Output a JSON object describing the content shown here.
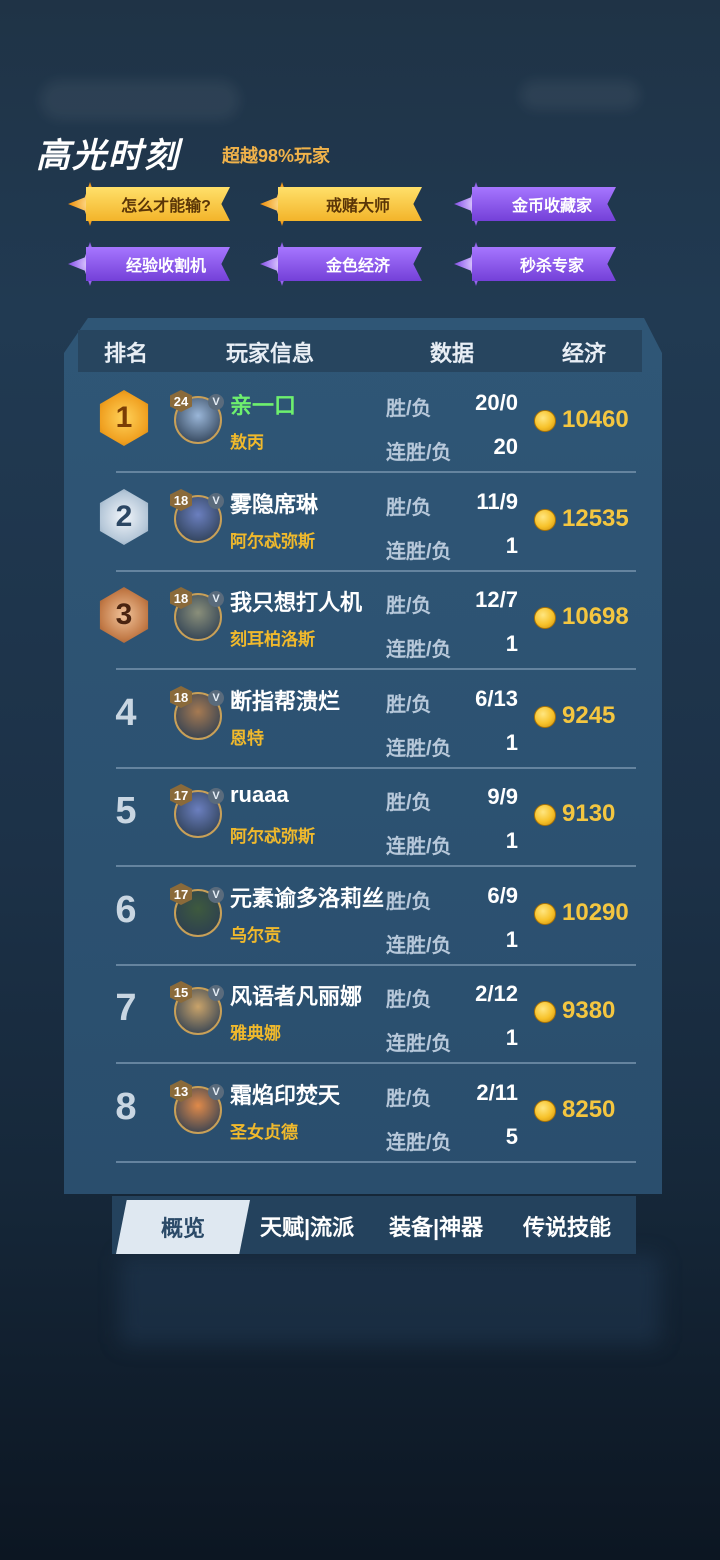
{
  "highlight": {
    "title": "高光时刻",
    "subtitle": "超越98%玩家",
    "badges": [
      {
        "label": "怎么才能输?",
        "style": "gold"
      },
      {
        "label": "戒赌大师",
        "style": "gold"
      },
      {
        "label": "金币收藏家",
        "style": "purple"
      },
      {
        "label": "经验收割机",
        "style": "purple"
      },
      {
        "label": "金色经济",
        "style": "purple"
      },
      {
        "label": "秒杀专家",
        "style": "purple"
      }
    ]
  },
  "table": {
    "headers": {
      "rank": "排名",
      "player": "玩家信息",
      "data": "数据",
      "economy": "经济"
    },
    "win_loss_label": "胜/负",
    "streak_label": "连胜/负",
    "rows": [
      {
        "rank": "1",
        "level": "24",
        "name": "亲一口",
        "hero": "敖丙",
        "win_loss": "20/0",
        "streak": "20",
        "gold": "10460",
        "is_self": true
      },
      {
        "rank": "2",
        "level": "18",
        "name": "雾隐席琳",
        "hero": "阿尔忒弥斯",
        "win_loss": "11/9",
        "streak": "1",
        "gold": "12535",
        "is_self": false
      },
      {
        "rank": "3",
        "level": "18",
        "name": "我只想打人机",
        "hero": "刻耳柏洛斯",
        "win_loss": "12/7",
        "streak": "1",
        "gold": "10698",
        "is_self": false
      },
      {
        "rank": "4",
        "level": "18",
        "name": "断指帮溃烂",
        "hero": "恩特",
        "win_loss": "6/13",
        "streak": "1",
        "gold": "9245",
        "is_self": false
      },
      {
        "rank": "5",
        "level": "17",
        "name": "ruaaa",
        "hero": "阿尔忒弥斯",
        "win_loss": "9/9",
        "streak": "1",
        "gold": "9130",
        "is_self": false
      },
      {
        "rank": "6",
        "level": "17",
        "name": "元素谕多洛莉丝",
        "hero": "乌尔贡",
        "win_loss": "6/9",
        "streak": "1",
        "gold": "10290",
        "is_self": false
      },
      {
        "rank": "7",
        "level": "15",
        "name": "风语者凡丽娜",
        "hero": "雅典娜",
        "win_loss": "2/12",
        "streak": "1",
        "gold": "9380",
        "is_self": false
      },
      {
        "rank": "8",
        "level": "13",
        "name": "霜焰印焚天",
        "hero": "圣女贞德",
        "win_loss": "2/11",
        "streak": "5",
        "gold": "8250",
        "is_self": false
      }
    ]
  },
  "tabs": [
    {
      "label": "概览",
      "active": true
    },
    {
      "label": "天赋|流派",
      "active": false
    },
    {
      "label": "装备|神器",
      "active": false
    },
    {
      "label": "传说技能",
      "active": false
    }
  ],
  "colors": {
    "gold_text": "#f4c640",
    "self_name": "#6ef06e",
    "hero_name": "#f0b92c",
    "subtitle": "#f0b24a"
  },
  "icons": {
    "medal_1": "gold-rank-medal-icon",
    "medal_2": "silver-rank-medal-icon",
    "medal_3": "bronze-rank-medal-icon",
    "coin": "gold-coin-icon",
    "badge_gold": "gold-star-badge-icon",
    "badge_purple": "purple-star-badge-icon"
  }
}
